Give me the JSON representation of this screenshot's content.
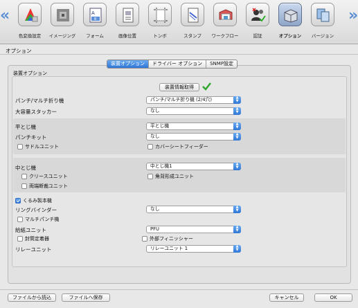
{
  "toolbar": {
    "items": [
      {
        "label": "色変換設定",
        "icon": "color-wheel-icon"
      },
      {
        "label": "イメージング",
        "icon": "imaging-icon"
      },
      {
        "label": "フォーム",
        "icon": "form-icon"
      },
      {
        "label": "画像位置",
        "icon": "image-position-icon"
      },
      {
        "label": "トンボ",
        "icon": "crop-marks-icon"
      },
      {
        "label": "スタンプ",
        "icon": "stamp-icon"
      },
      {
        "label": "ワークフロー",
        "icon": "workflow-icon"
      },
      {
        "label": "認証",
        "icon": "authentication-icon"
      },
      {
        "label": "オプション",
        "icon": "options-icon"
      },
      {
        "label": "バージョン",
        "icon": "version-icon"
      }
    ],
    "active": "オプション"
  },
  "section_title": "オプション",
  "tabs": [
    "装置オプション",
    "ドライバー オプション",
    "SNMP設定"
  ],
  "active_tab": "装置オプション",
  "panel_title": "装置オプション",
  "get_device_info_button": "装置情報取得",
  "rows": {
    "punch": {
      "label": "パンチ/マルチ折り機",
      "value": "パンチ/マルチ折り機 (2/4穴)"
    },
    "stacker": {
      "label": "大容量スタッカー",
      "value": "なし"
    },
    "flat_stitch": {
      "label": "平とじ機",
      "value": "平とじ機"
    },
    "punch_kit": {
      "label": "パンチキット",
      "value": "なし"
    },
    "saddle_unit": {
      "label": "サドルユニット",
      "checked": false
    },
    "cover_feeder": {
      "label": "カバーシートフィーダー",
      "checked": false
    },
    "center_stitch": {
      "label": "中とじ機",
      "value": "中とじ機1"
    },
    "crease_unit": {
      "label": "クリースユニット",
      "checked": false
    },
    "square_spine": {
      "label": "角背形成ユニット",
      "checked": false
    },
    "both_edge_trim": {
      "label": "両端断裁ユニット",
      "checked": false
    },
    "perfect_binder": {
      "label": "くるみ製本機",
      "checked": true
    },
    "ring_binder": {
      "label": "リングバインダー",
      "value": "なし"
    },
    "multi_punch": {
      "label": "マルチパンチ機",
      "checked": false
    },
    "paper_feed": {
      "label": "給紙ユニット",
      "value": "PFU"
    },
    "envelope_sealer": {
      "label": "封筒定着器",
      "checked": false
    },
    "external_finisher": {
      "label": "外部フィニッシャー",
      "checked": false
    },
    "relay_unit": {
      "label": "リレーユニット",
      "value": "リレーユニット 1"
    }
  },
  "footer": {
    "load_from_file": "ファイルから読込",
    "save_to_file": "ファイルへ保存",
    "cancel": "キャンセル",
    "ok": "OK"
  },
  "colors": {
    "accent": "#2f76d6",
    "check_green": "#2fa82f"
  }
}
